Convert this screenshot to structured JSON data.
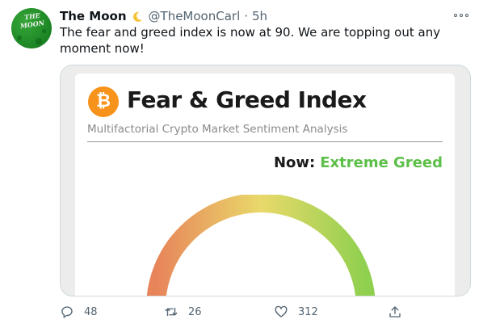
{
  "tweet": {
    "avatar": {
      "logo_text_line1": "THE",
      "logo_text_line2": "MOON",
      "icon": "moon-logo-avatar"
    },
    "display_name": "The Moon",
    "name_emoji_icon": "crescent-moon-icon",
    "handle": "@TheMoonCarl",
    "separator": "·",
    "time": "5h",
    "text": "The fear and greed index is now at 90. We are topping out any moment now!",
    "more_icon": "more-options-icon"
  },
  "media": {
    "logo_icon": "bitcoin-icon",
    "logo_glyph": "₿",
    "title": "Fear & Greed Index",
    "subtitle": "Multifactorial Crypto Market Sentiment Analysis",
    "now_label": "Now:",
    "now_value": "Extreme Greed",
    "colors": {
      "bitcoin": "#f7931a",
      "greed_text": "#5cbf48",
      "gauge_start": "#e8845a",
      "gauge_mid": "#e9d96a",
      "gauge_end": "#8fd04f"
    }
  },
  "actions": {
    "reply": {
      "icon": "reply-icon",
      "count": "48"
    },
    "retweet": {
      "icon": "retweet-icon",
      "count": "26"
    },
    "like": {
      "icon": "heart-icon",
      "count": "312"
    },
    "share": {
      "icon": "share-icon"
    }
  }
}
